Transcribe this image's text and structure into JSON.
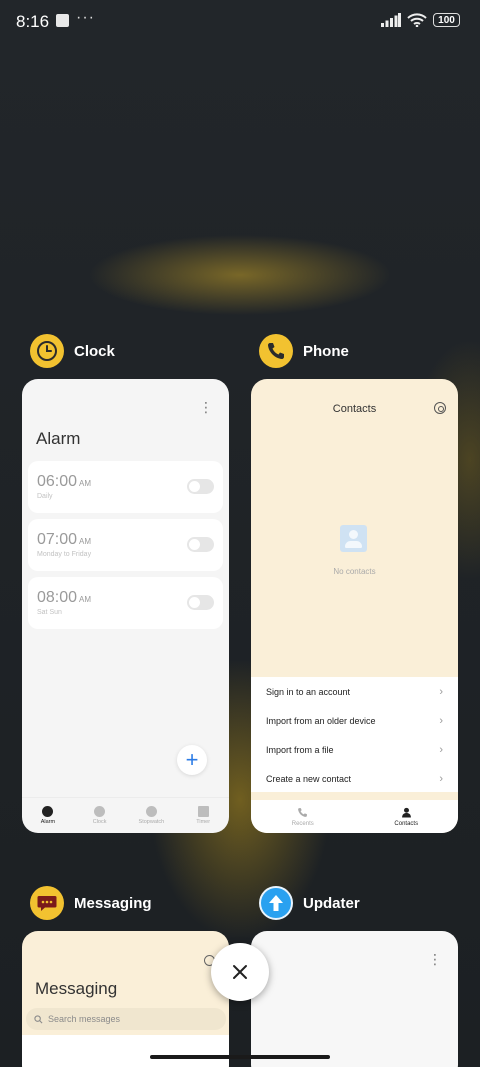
{
  "status_bar": {
    "time": "8:16",
    "dots": "···",
    "battery": "100"
  },
  "colors": {
    "clock_icon": "#f2c230",
    "phone_icon": "#f2c230",
    "messaging_icon": "#f2c230",
    "updater_icon": "#2aa1f0",
    "accent_blue": "#2c7be5"
  },
  "apps": {
    "clock": {
      "name": "Clock",
      "icon": "clock-icon",
      "screen": {
        "title": "Alarm",
        "alarms": [
          {
            "time": "06:00",
            "ampm": "AM",
            "repeat": "Daily"
          },
          {
            "time": "07:00",
            "ampm": "AM",
            "repeat": "Monday to Friday"
          },
          {
            "time": "08:00",
            "ampm": "AM",
            "repeat": "Sat Sun"
          }
        ],
        "fab_label": "+",
        "nav": [
          {
            "label": "Alarm",
            "icon": "alarm-icon",
            "active": true
          },
          {
            "label": "Clock",
            "icon": "clock-icon",
            "active": false
          },
          {
            "label": "Stopwatch",
            "icon": "stopwatch-icon",
            "active": false
          },
          {
            "label": "Timer",
            "icon": "hourglass-icon",
            "active": false
          }
        ]
      }
    },
    "phone": {
      "name": "Phone",
      "icon": "phone-icon",
      "screen": {
        "title": "Contacts",
        "empty_text": "No contacts",
        "actions": [
          "Sign in to an account",
          "Import from an older device",
          "Import from a file",
          "Create a new contact"
        ],
        "nav": [
          {
            "label": "Recents",
            "icon": "phone-icon",
            "active": false
          },
          {
            "label": "Contacts",
            "icon": "person-icon",
            "active": true
          }
        ]
      }
    },
    "messaging": {
      "name": "Messaging",
      "icon": "chat-bubble-icon",
      "screen": {
        "title": "Messaging",
        "search_placeholder": "Search messages"
      }
    },
    "updater": {
      "name": "Updater",
      "icon": "upload-arrow-icon"
    }
  },
  "close_icon": "close-icon"
}
